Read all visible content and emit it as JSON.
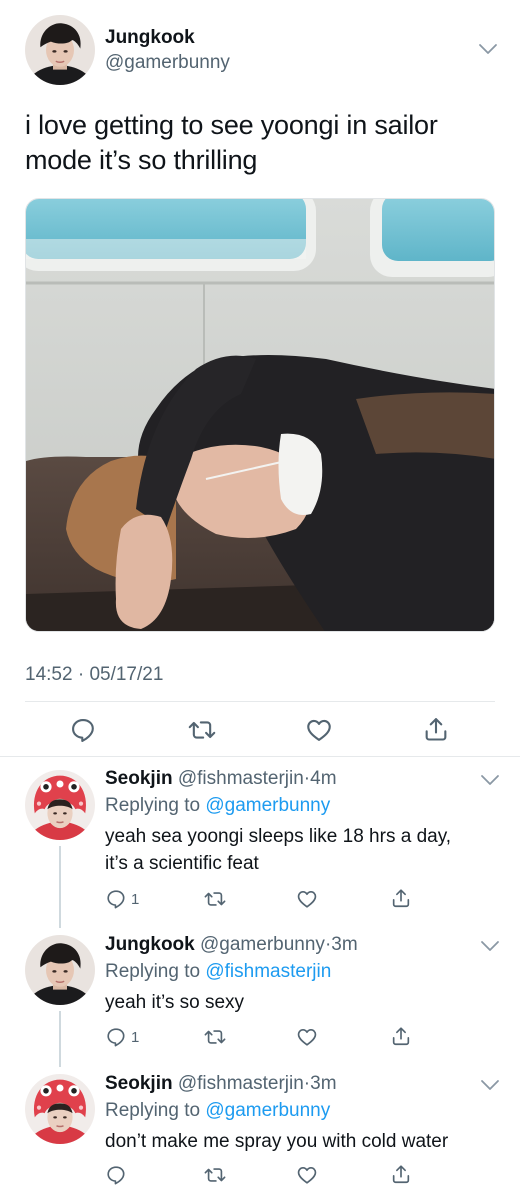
{
  "main_tweet": {
    "author_name": "Jungkook",
    "author_handle": "@gamerbunny",
    "text_line1": "i love getting to see yoongi in sailor",
    "text_line2": "mode it’s so thrilling",
    "time": "14:52",
    "separator": "·",
    "date": "05/17/21",
    "media_icon": "photo-of-person-sleeping-on-boat-bench"
  },
  "replies": [
    {
      "author_name": "Seokjin",
      "author_handle": "@fishmasterjin",
      "separator": "·",
      "age": "4m",
      "replying_prefix": "Replying to ",
      "replying_to": "@gamerbunny",
      "text_line1": "yeah sea yoongi sleeps like 18 hrs a day,",
      "text_line2": "it’s a scientific feat",
      "reply_count": "1"
    },
    {
      "author_name": "Jungkook",
      "author_handle": "@gamerbunny",
      "separator": "·",
      "age": "3m",
      "replying_prefix": "Replying to ",
      "replying_to": "@fishmasterjin",
      "text_line1": "yeah it’s so sexy",
      "reply_count": "1"
    },
    {
      "author_name": "Seokjin",
      "author_handle": "@fishmasterjin",
      "separator": "·",
      "age": "3m",
      "replying_prefix": "Replying to ",
      "replying_to": "@gamerbunny",
      "text_line1": "don’t make me spray you with cold water"
    }
  ],
  "icons": {
    "reply": "reply-icon",
    "retweet": "retweet-icon",
    "like": "heart-icon",
    "share": "share-icon",
    "more": "chevron-down-icon"
  },
  "colors": {
    "text": "#0f1419",
    "secondary": "#536471",
    "link": "#1d9bf0",
    "divider": "#e6e9eb"
  }
}
